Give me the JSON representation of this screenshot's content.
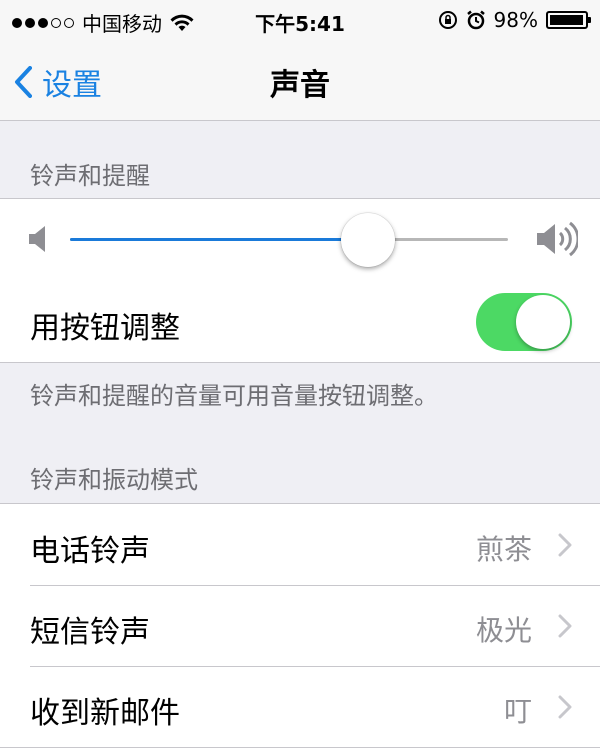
{
  "status_bar": {
    "signal_bars_filled": 3,
    "signal_bars_total": 5,
    "carrier": "中国移动",
    "time": "下午5:41",
    "battery_percent": "98%",
    "battery_level": 0.98,
    "icons": [
      "wifi-icon",
      "rotation-lock-icon",
      "alarm-icon",
      "battery-icon"
    ]
  },
  "nav": {
    "back_label": "设置",
    "title": "声音"
  },
  "ringer_section": {
    "header": "铃声和提醒",
    "volume_level": 0.68,
    "change_with_buttons_label": "用按钮调整",
    "change_with_buttons_on": true,
    "footer": "铃声和提醒的音量可用音量按钮调整。"
  },
  "patterns_section": {
    "header": "铃声和振动模式",
    "items": [
      {
        "label": "电话铃声",
        "value": "煎茶"
      },
      {
        "label": "短信铃声",
        "value": "极光"
      },
      {
        "label": "收到新邮件",
        "value": "叮"
      }
    ]
  },
  "colors": {
    "accent": "#1a82e2",
    "switch_on": "#4cd964",
    "background": "#efeff4"
  }
}
